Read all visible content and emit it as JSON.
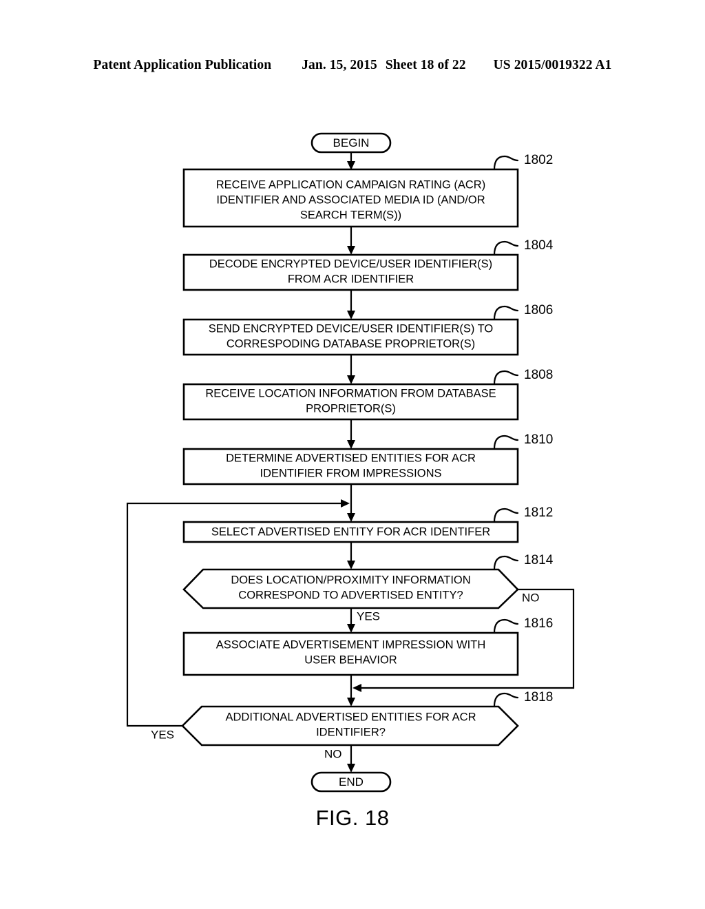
{
  "header": {
    "publication": "Patent Application Publication",
    "date": "Jan. 15, 2015",
    "sheet": "Sheet 18 of 22",
    "patent_number": "US 2015/0019322 A1"
  },
  "figure": {
    "caption": "FIG. 18"
  },
  "flowchart": {
    "start": {
      "label": "BEGIN"
    },
    "end": {
      "label": "END"
    },
    "steps": [
      {
        "ref": "1802",
        "type": "process",
        "lines": [
          "RECEIVE APPLICATION CAMPAIGN RATING (ACR)",
          "IDENTIFIER AND ASSOCIATED MEDIA ID (AND/OR",
          "SEARCH TERM(S))"
        ]
      },
      {
        "ref": "1804",
        "type": "process",
        "lines": [
          "DECODE ENCRYPTED DEVICE/USER IDENTIFIER(S)",
          "FROM ACR IDENTIFIER"
        ]
      },
      {
        "ref": "1806",
        "type": "process",
        "lines": [
          "SEND ENCRYPTED DEVICE/USER IDENTIFIER(S) TO",
          "CORRESPODING DATABASE PROPRIETOR(S)"
        ]
      },
      {
        "ref": "1808",
        "type": "process",
        "lines": [
          "RECEIVE LOCATION INFORMATION FROM DATABASE",
          "PROPRIETOR(S)"
        ]
      },
      {
        "ref": "1810",
        "type": "process",
        "lines": [
          "DETERMINE ADVERTISED ENTITIES FOR ACR",
          "IDENTIFIER FROM IMPRESSIONS"
        ]
      },
      {
        "ref": "1812",
        "type": "process",
        "lines": [
          "SELECT ADVERTISED ENTITY FOR ACR IDENTIFER"
        ]
      },
      {
        "ref": "1814",
        "type": "decision",
        "lines": [
          "DOES LOCATION/PROXIMITY INFORMATION",
          "CORRESPOND TO ADVERTISED ENTITY?"
        ]
      },
      {
        "ref": "1816",
        "type": "process",
        "lines": [
          "ASSOCIATE ADVERTISEMENT IMPRESSION WITH",
          "USER BEHAVIOR"
        ]
      },
      {
        "ref": "1818",
        "type": "decision",
        "lines": [
          "ADDITIONAL ADVERTISED ENTITIES FOR ACR",
          "IDENTIFIER?"
        ]
      }
    ],
    "branch_labels": {
      "decision_1814_yes": "YES",
      "decision_1814_no": "NO",
      "decision_1818_yes": "YES",
      "decision_1818_no": "NO"
    },
    "colors": {
      "stroke": "#000000",
      "fill": "#ffffff",
      "text": "#000000"
    }
  }
}
